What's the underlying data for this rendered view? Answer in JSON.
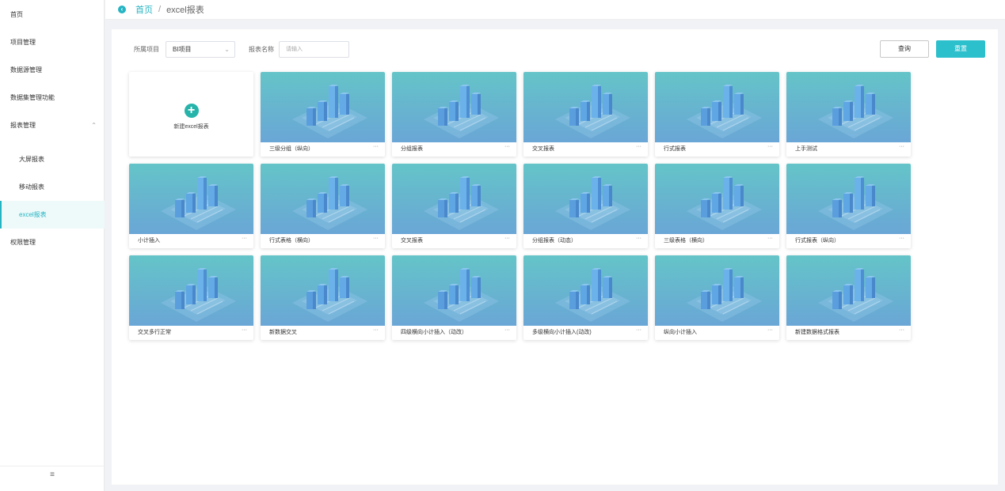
{
  "sidebar": {
    "items": [
      {
        "label": "首页"
      },
      {
        "label": "项目管理"
      },
      {
        "label": "数据源管理"
      },
      {
        "label": "数据集管理功能"
      },
      {
        "label": "报表管理"
      },
      {
        "label": "大屏报表"
      },
      {
        "label": "移动报表"
      },
      {
        "label": "excel报表"
      },
      {
        "label": "权限管理"
      }
    ],
    "collapse_icon": "≡"
  },
  "breadcrumb": {
    "home": "首页",
    "separator": "/",
    "current": "excel报表"
  },
  "filters": {
    "project_label": "所属项目",
    "project_value": "BI项目",
    "name_label": "报表名称",
    "name_placeholder": "请输入",
    "query_button": "查询",
    "reset_button": "重置"
  },
  "new_card": {
    "label": "新建excel报表"
  },
  "reports": [
    {
      "name": "三级分组（纵向）"
    },
    {
      "name": "分组报表"
    },
    {
      "name": "交叉报表"
    },
    {
      "name": "行式报表"
    },
    {
      "name": "上手测试"
    },
    {
      "name": "小计插入"
    },
    {
      "name": "行式表格（横向）"
    },
    {
      "name": "交叉报表"
    },
    {
      "name": "分组报表（动态）"
    },
    {
      "name": "三级表格（横向）"
    },
    {
      "name": "行式报表（纵向）"
    },
    {
      "name": "交叉多行正常"
    },
    {
      "name": "新数据交叉"
    },
    {
      "name": "四级横向小计插入（动改）"
    },
    {
      "name": "多级横向小计插入(动改)"
    },
    {
      "name": "纵向小计插入"
    },
    {
      "name": "新建数据格式报表"
    }
  ],
  "more_label": "···",
  "colors": {
    "accent": "#26b4c3",
    "thumb_top": "#64c4c8",
    "thumb_bottom": "#6aa6d6"
  }
}
